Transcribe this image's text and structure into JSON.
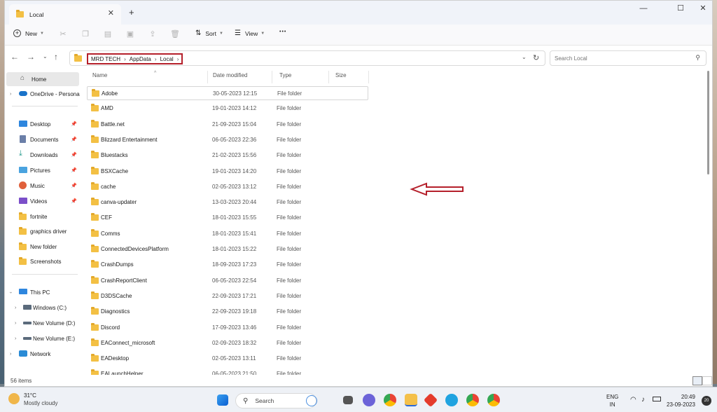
{
  "window": {
    "tab_title": "Local",
    "close_tab": "✕",
    "new_tab": "+",
    "minimize": "—",
    "maximize": "☐",
    "close": "✕"
  },
  "toolbar": {
    "new_label": "New",
    "sort_label": "Sort",
    "view_label": "View",
    "more_label": "•••"
  },
  "address": {
    "crumbs": [
      "MRD TECH",
      "AppData",
      "Local"
    ],
    "separator": "›"
  },
  "search": {
    "placeholder": "Search Local"
  },
  "sidebar": {
    "home": "Home",
    "onedrive": "OneDrive - Persona",
    "quick": [
      "Desktop",
      "Documents",
      "Downloads",
      "Pictures",
      "Music",
      "Videos",
      "fortnite",
      "graphics driver",
      "New folder",
      "Screenshots"
    ],
    "this_pc": "This PC",
    "drives": [
      "Windows (C:)",
      "New Volume (D:)",
      "New Volume (E:)"
    ],
    "network": "Network"
  },
  "columns": {
    "name": "Name",
    "date": "Date modified",
    "type": "Type",
    "size": "Size"
  },
  "files": [
    {
      "name": "Adobe",
      "date": "30-05-2023 12:15",
      "type": "File folder"
    },
    {
      "name": "AMD",
      "date": "19-01-2023 14:12",
      "type": "File folder"
    },
    {
      "name": "Battle.net",
      "date": "21-09-2023 15:04",
      "type": "File folder"
    },
    {
      "name": "Blizzard Entertainment",
      "date": "06-05-2023 22:36",
      "type": "File folder"
    },
    {
      "name": "Bluestacks",
      "date": "21-02-2023 15:56",
      "type": "File folder"
    },
    {
      "name": "BSXCache",
      "date": "19-01-2023 14:20",
      "type": "File folder"
    },
    {
      "name": "cache",
      "date": "02-05-2023 13:12",
      "type": "File folder"
    },
    {
      "name": "canva-updater",
      "date": "13-03-2023 20:44",
      "type": "File folder"
    },
    {
      "name": "CEF",
      "date": "18-01-2023 15:55",
      "type": "File folder"
    },
    {
      "name": "Comms",
      "date": "18-01-2023 15:41",
      "type": "File folder"
    },
    {
      "name": "ConnectedDevicesPlatform",
      "date": "18-01-2023 15:22",
      "type": "File folder"
    },
    {
      "name": "CrashDumps",
      "date": "18-09-2023 17:23",
      "type": "File folder"
    },
    {
      "name": "CrashReportClient",
      "date": "06-05-2023 22:54",
      "type": "File folder"
    },
    {
      "name": "D3DSCache",
      "date": "22-09-2023 17:21",
      "type": "File folder"
    },
    {
      "name": "Diagnostics",
      "date": "22-09-2023 19:18",
      "type": "File folder"
    },
    {
      "name": "Discord",
      "date": "17-09-2023 13:46",
      "type": "File folder"
    },
    {
      "name": "EAConnect_microsoft",
      "date": "02-09-2023 18:32",
      "type": "File folder"
    },
    {
      "name": "EADesktop",
      "date": "02-05-2023 13:11",
      "type": "File folder"
    },
    {
      "name": "EALaunchHelper",
      "date": "06-05-2023 21:50",
      "type": "File folder"
    }
  ],
  "status": {
    "count": "56 items"
  },
  "taskbar": {
    "temp": "31°C",
    "weather": "Mostly cloudy",
    "search": "Search",
    "lang1": "ENG",
    "lang2": "IN",
    "time": "20:49",
    "date": "23-09-2023",
    "badge": "20"
  },
  "colors": {
    "annotation": "#b5202b",
    "folder": "#f3c044",
    "accent": "#0067c0"
  }
}
